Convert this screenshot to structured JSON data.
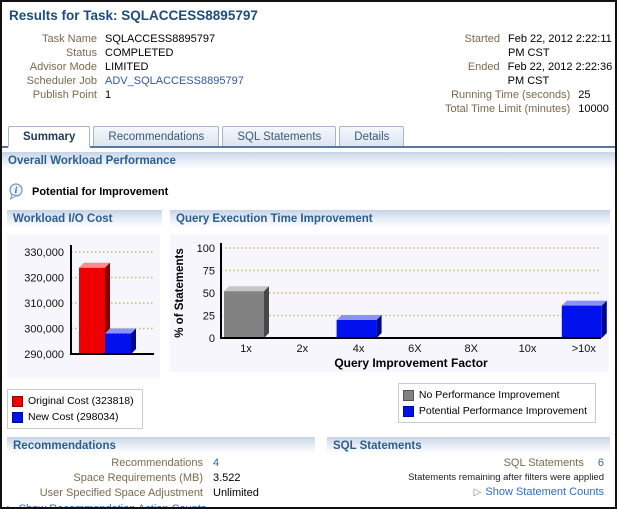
{
  "page": {
    "title": "Results for Task: SQLACCESS8895797"
  },
  "task_info": {
    "left": [
      {
        "label": "Task Name",
        "value": "SQLACCESS8895797"
      },
      {
        "label": "Status",
        "value": "COMPLETED"
      },
      {
        "label": "Advisor Mode",
        "value": "LIMITED"
      },
      {
        "label": "Scheduler Job",
        "value": "ADV_SQLACCESS8895797",
        "is_link": true
      },
      {
        "label": "Publish Point",
        "value": "1"
      }
    ],
    "right": [
      {
        "label": "Started",
        "value": "Feb 22, 2012 2:22:11 PM CST"
      },
      {
        "label": "Ended",
        "value": "Feb 22, 2012 2:22:36 PM CST"
      },
      {
        "label": "Running Time (seconds)",
        "value": "25"
      },
      {
        "label": "Total Time Limit (minutes)",
        "value": "10000"
      }
    ]
  },
  "tabs": [
    {
      "label": "Summary",
      "active": true
    },
    {
      "label": "Recommendations",
      "active": false
    },
    {
      "label": "SQL Statements",
      "active": false
    },
    {
      "label": "Details",
      "active": false
    }
  ],
  "sections": {
    "overall_title": "Overall Workload Performance",
    "potential_label": "Potential for Improvement"
  },
  "icons": {
    "info_tip": "ⓘ",
    "expand": "▷"
  },
  "chart_data": [
    {
      "type": "bar",
      "title": "Workload I/O Cost",
      "categories": [
        "Original Cost",
        "New Cost"
      ],
      "values": [
        323818,
        298034
      ],
      "bar_colors": [
        "#ee0000",
        "#0011ee"
      ],
      "ylim": [
        290000,
        330000
      ],
      "yticks": [
        290000,
        300000,
        310000,
        320000,
        330000
      ],
      "ytick_labels": [
        "290,000",
        "300,000",
        "310,000",
        "320,000",
        "330,000"
      ],
      "grid": "dotted-horizontal",
      "legend_position": "below-left",
      "legend": [
        {
          "label": "Original Cost (323818)",
          "color": "#ee0000"
        },
        {
          "label": "New Cost (298034)",
          "color": "#0011ee"
        }
      ]
    },
    {
      "type": "bar",
      "title": "Query Execution Time Improvement",
      "categories": [
        "1x",
        "2x",
        "4x",
        "6X",
        "8X",
        "10x",
        ">10x"
      ],
      "values": [
        52,
        0,
        20,
        0,
        0,
        0,
        36
      ],
      "bar_colors": [
        "#828282",
        "#0011ee",
        "#0011ee",
        "#0011ee",
        "#0011ee",
        "#0011ee",
        "#0011ee"
      ],
      "xlabel": "Query Improvement Factor",
      "ylabel": "% of Statements",
      "ylim": [
        0,
        100
      ],
      "yticks": [
        0,
        25,
        50,
        75,
        100
      ],
      "grid": "dotted-horizontal",
      "legend_position": "below-right",
      "legend": [
        {
          "label": "No Performance Improvement",
          "color": "#828282"
        },
        {
          "label": "Potential Performance Improvement",
          "color": "#0011ee"
        }
      ]
    }
  ],
  "recommendations_panel": {
    "title": "Recommendations",
    "rows": [
      {
        "label": "Recommendations",
        "value": "4",
        "value_style": "link"
      },
      {
        "label": "Space Requirements (MB)",
        "value": "3.522"
      },
      {
        "label": "User Specified Space Adjustment",
        "value": "Unlimited"
      }
    ],
    "expand_link": {
      "label": "Show Recommendation Action Counts"
    }
  },
  "sql_panel": {
    "title": "SQL Statements",
    "rows": [
      {
        "label": "SQL Statements",
        "value": "6",
        "value_style": "link"
      }
    ],
    "note": "Statements remaining after filters were applied",
    "expand_link": {
      "label": "Show Statement Counts"
    }
  },
  "colors": {
    "accent_header_text": "#2a5e8f",
    "page_title": "#1d4d7c",
    "label_brown": "#7a6a4d",
    "link_blue": "#3355aa",
    "action_link_blue": "#2f6bc0",
    "value_link": "#336699",
    "plot_background": "#f6f6fc",
    "gridline_dots": "#c9ba6e",
    "bar_red": "#ee0000",
    "bar_blue": "#0011ee",
    "bar_gray": "#828282",
    "tab_line": "#567a9e"
  }
}
